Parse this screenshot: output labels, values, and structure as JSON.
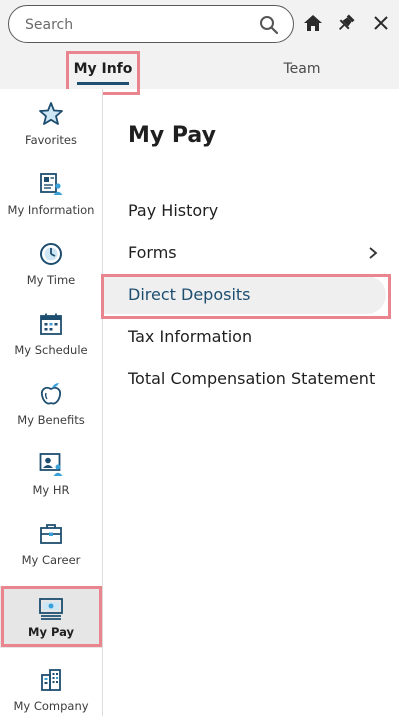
{
  "search": {
    "placeholder": "Search"
  },
  "header_icons": [
    "search-icon",
    "home-icon",
    "pin-icon",
    "close-icon"
  ],
  "tabs": [
    {
      "label": "My Info",
      "active": true
    },
    {
      "label": "Team",
      "active": false
    }
  ],
  "sidebar": {
    "items": [
      {
        "label": "Favorites",
        "icon": "star-icon"
      },
      {
        "label": "My Information",
        "icon": "id-card-icon"
      },
      {
        "label": "My Time",
        "icon": "clock-icon"
      },
      {
        "label": "My Schedule",
        "icon": "calendar-icon"
      },
      {
        "label": "My Benefits",
        "icon": "apple-icon"
      },
      {
        "label": "My HR",
        "icon": "person-board-icon"
      },
      {
        "label": "My Career",
        "icon": "briefcase-icon"
      },
      {
        "label": "My Pay",
        "icon": "pay-stub-icon",
        "active": true
      },
      {
        "label": "My Company",
        "icon": "building-icon"
      }
    ]
  },
  "content": {
    "title": "My Pay",
    "menu": [
      {
        "label": "Pay History"
      },
      {
        "label": "Forms",
        "has_submenu": true
      },
      {
        "label": "Direct Deposits",
        "selected": true
      },
      {
        "label": "Tax Information"
      },
      {
        "label": "Total Compensation Statement"
      }
    ]
  },
  "colors": {
    "accent": "#1d4e70",
    "highlight": "#e8858f",
    "icon": "#1d4e70",
    "icon_secondary": "#3aa0d8"
  }
}
